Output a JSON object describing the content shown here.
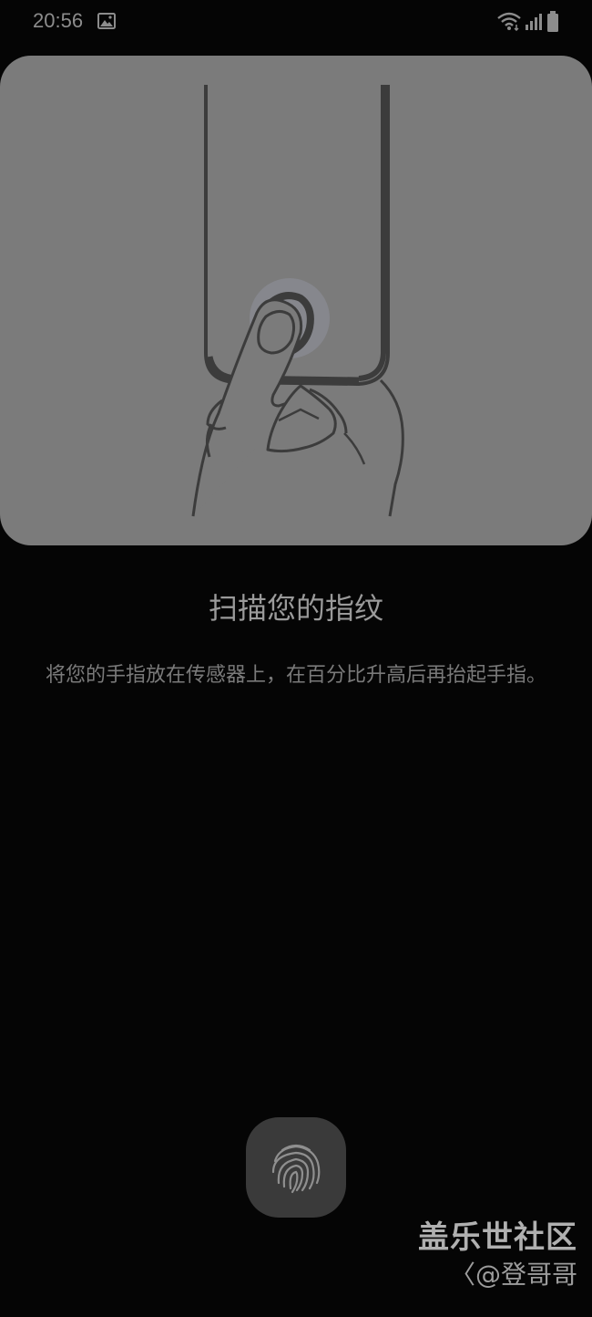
{
  "status_bar": {
    "time": "20:56",
    "icons": [
      "gallery-icon",
      "wifi-icon",
      "signal-icon",
      "battery-icon"
    ]
  },
  "illustration": {
    "icon": "finger-on-phone-illustration"
  },
  "title": "扫描您的指纹",
  "instruction": "将您的手指放在传感器上，在百分比升高后再抬起手指。",
  "sensor": {
    "icon": "fingerprint-icon"
  },
  "watermark": {
    "title": "盖乐世社区",
    "author": "〈@登哥哥"
  },
  "colors": {
    "background": "#050505",
    "card": "#7b7b7b",
    "sensor": "#3a3a3a"
  }
}
